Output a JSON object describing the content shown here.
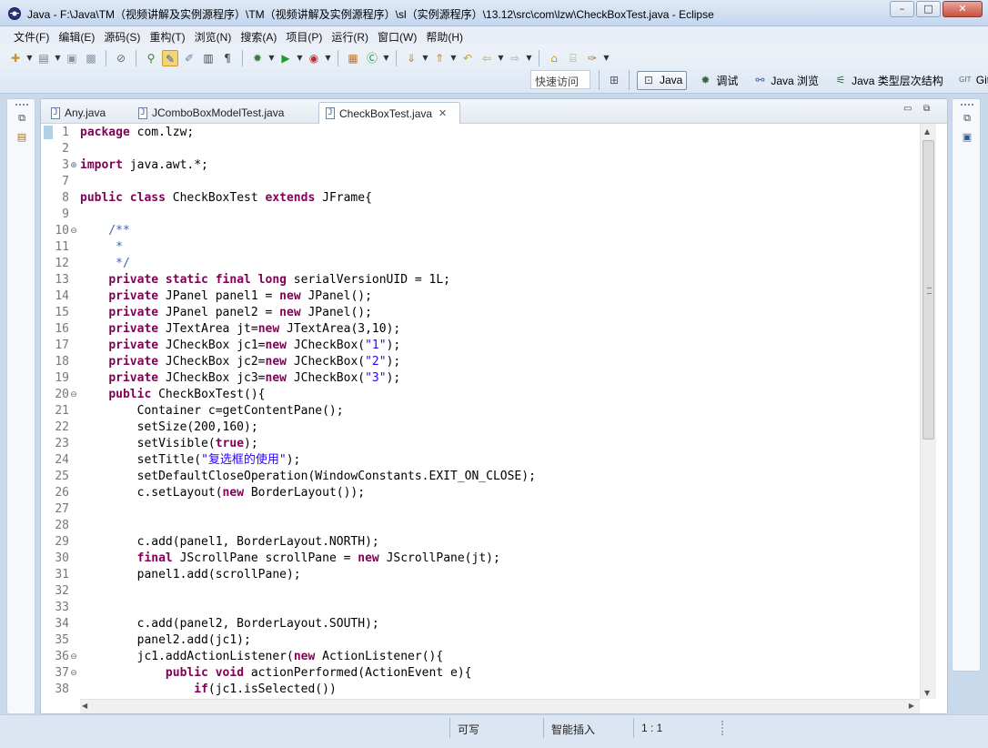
{
  "window": {
    "title": "Java  -  F:\\Java\\TM（视频讲解及实例源程序）\\TM（视频讲解及实例源程序）\\sl（实例源程序）\\13.12\\src\\com\\lzw\\CheckBoxTest.java  -  Eclipse",
    "minimize_glyph": "–",
    "maximize_glyph": "□",
    "close_glyph": "✕"
  },
  "menu": [
    "文件(F)",
    "编辑(E)",
    "源码(S)",
    "重构(T)",
    "浏览(N)",
    "搜索(A)",
    "项目(P)",
    "运行(R)",
    "窗口(W)",
    "帮助(H)"
  ],
  "toolbar": {
    "quick_access": "快速访问",
    "perspectives": [
      {
        "label": "Java",
        "icon": "java-perspective-icon",
        "active": true
      },
      {
        "label": "调试",
        "icon": "debug-icon",
        "active": false
      },
      {
        "label": "Java 浏览",
        "icon": "java-browse-icon",
        "active": false
      },
      {
        "label": "Java 类型层次结构",
        "icon": "type-hierarchy-icon",
        "active": false
      },
      {
        "label": "Git",
        "icon": "git-icon",
        "active": false
      }
    ]
  },
  "editor": {
    "tabs": [
      {
        "label": "Any.java",
        "active": false
      },
      {
        "label": "JComboBoxModelTest.java",
        "active": false
      },
      {
        "label": "CheckBoxTest.java",
        "active": true
      }
    ],
    "lines": [
      {
        "n": "1",
        "fold": "",
        "tokens": [
          {
            "c": "kw",
            "t": "package"
          },
          {
            "c": "",
            "t": " com.lzw;"
          }
        ]
      },
      {
        "n": "2",
        "fold": "",
        "tokens": []
      },
      {
        "n": "3",
        "fold": "plus",
        "tokens": [
          {
            "c": "kw",
            "t": "import"
          },
          {
            "c": "",
            "t": " java.awt.*;"
          }
        ]
      },
      {
        "n": "7",
        "fold": "",
        "tokens": []
      },
      {
        "n": "8",
        "fold": "",
        "tokens": [
          {
            "c": "kw",
            "t": "public class"
          },
          {
            "c": "",
            "t": " CheckBoxTest "
          },
          {
            "c": "kw",
            "t": "extends"
          },
          {
            "c": "",
            "t": " JFrame{"
          }
        ]
      },
      {
        "n": "9",
        "fold": "",
        "tokens": []
      },
      {
        "n": "10",
        "fold": "minus",
        "tokens": [
          {
            "c": "cmt",
            "t": "    /**"
          }
        ]
      },
      {
        "n": "11",
        "fold": "",
        "tokens": [
          {
            "c": "cmt",
            "t": "     *"
          }
        ]
      },
      {
        "n": "12",
        "fold": "",
        "tokens": [
          {
            "c": "cmt",
            "t": "     */"
          }
        ]
      },
      {
        "n": "13",
        "fold": "",
        "tokens": [
          {
            "c": "",
            "t": "    "
          },
          {
            "c": "kw",
            "t": "private static final long"
          },
          {
            "c": "",
            "t": " serialVersionUID = 1L;"
          }
        ]
      },
      {
        "n": "14",
        "fold": "",
        "tokens": [
          {
            "c": "",
            "t": "    "
          },
          {
            "c": "kw",
            "t": "private"
          },
          {
            "c": "",
            "t": " JPanel panel1 = "
          },
          {
            "c": "kw",
            "t": "new"
          },
          {
            "c": "",
            "t": " JPanel();"
          }
        ]
      },
      {
        "n": "15",
        "fold": "",
        "tokens": [
          {
            "c": "",
            "t": "    "
          },
          {
            "c": "kw",
            "t": "private"
          },
          {
            "c": "",
            "t": " JPanel panel2 = "
          },
          {
            "c": "kw",
            "t": "new"
          },
          {
            "c": "",
            "t": " JPanel();"
          }
        ]
      },
      {
        "n": "16",
        "fold": "",
        "tokens": [
          {
            "c": "",
            "t": "    "
          },
          {
            "c": "kw",
            "t": "private"
          },
          {
            "c": "",
            "t": " JTextArea jt="
          },
          {
            "c": "kw",
            "t": "new"
          },
          {
            "c": "",
            "t": " JTextArea(3,10);"
          }
        ]
      },
      {
        "n": "17",
        "fold": "",
        "tokens": [
          {
            "c": "",
            "t": "    "
          },
          {
            "c": "kw",
            "t": "private"
          },
          {
            "c": "",
            "t": " JCheckBox jc1="
          },
          {
            "c": "kw",
            "t": "new"
          },
          {
            "c": "",
            "t": " JCheckBox("
          },
          {
            "c": "str",
            "t": "\"1\""
          },
          {
            "c": "",
            "t": ");"
          }
        ]
      },
      {
        "n": "18",
        "fold": "",
        "tokens": [
          {
            "c": "",
            "t": "    "
          },
          {
            "c": "kw",
            "t": "private"
          },
          {
            "c": "",
            "t": " JCheckBox jc2="
          },
          {
            "c": "kw",
            "t": "new"
          },
          {
            "c": "",
            "t": " JCheckBox("
          },
          {
            "c": "str",
            "t": "\"2\""
          },
          {
            "c": "",
            "t": ");"
          }
        ]
      },
      {
        "n": "19",
        "fold": "",
        "tokens": [
          {
            "c": "",
            "t": "    "
          },
          {
            "c": "kw",
            "t": "private"
          },
          {
            "c": "",
            "t": " JCheckBox jc3="
          },
          {
            "c": "kw",
            "t": "new"
          },
          {
            "c": "",
            "t": " JCheckBox("
          },
          {
            "c": "str",
            "t": "\"3\""
          },
          {
            "c": "",
            "t": ");"
          }
        ]
      },
      {
        "n": "20",
        "fold": "minus",
        "tokens": [
          {
            "c": "",
            "t": "    "
          },
          {
            "c": "kw",
            "t": "public"
          },
          {
            "c": "",
            "t": " CheckBoxTest(){"
          }
        ]
      },
      {
        "n": "21",
        "fold": "",
        "tokens": [
          {
            "c": "",
            "t": "        Container c=getContentPane();"
          }
        ]
      },
      {
        "n": "22",
        "fold": "",
        "tokens": [
          {
            "c": "",
            "t": "        setSize(200,160);"
          }
        ]
      },
      {
        "n": "23",
        "fold": "",
        "tokens": [
          {
            "c": "",
            "t": "        setVisible("
          },
          {
            "c": "kw",
            "t": "true"
          },
          {
            "c": "",
            "t": ");"
          }
        ]
      },
      {
        "n": "24",
        "fold": "",
        "tokens": [
          {
            "c": "",
            "t": "        setTitle("
          },
          {
            "c": "str",
            "t": "\"复选框的使用\""
          },
          {
            "c": "",
            "t": ");"
          }
        ]
      },
      {
        "n": "25",
        "fold": "",
        "tokens": [
          {
            "c": "",
            "t": "        setDefaultCloseOperation(WindowConstants.EXIT_ON_CLOSE);"
          }
        ]
      },
      {
        "n": "26",
        "fold": "",
        "tokens": [
          {
            "c": "",
            "t": "        c.setLayout("
          },
          {
            "c": "kw",
            "t": "new"
          },
          {
            "c": "",
            "t": " BorderLayout());"
          }
        ]
      },
      {
        "n": "27",
        "fold": "",
        "tokens": []
      },
      {
        "n": "28",
        "fold": "",
        "tokens": []
      },
      {
        "n": "29",
        "fold": "",
        "tokens": [
          {
            "c": "",
            "t": "        c.add(panel1, BorderLayout.NORTH);"
          }
        ]
      },
      {
        "n": "30",
        "fold": "",
        "tokens": [
          {
            "c": "",
            "t": "        "
          },
          {
            "c": "kw",
            "t": "final"
          },
          {
            "c": "",
            "t": " JScrollPane scrollPane = "
          },
          {
            "c": "kw",
            "t": "new"
          },
          {
            "c": "",
            "t": " JScrollPane(jt);"
          }
        ]
      },
      {
        "n": "31",
        "fold": "",
        "tokens": [
          {
            "c": "",
            "t": "        panel1.add(scrollPane);"
          }
        ]
      },
      {
        "n": "32",
        "fold": "",
        "tokens": []
      },
      {
        "n": "33",
        "fold": "",
        "tokens": []
      },
      {
        "n": "34",
        "fold": "",
        "tokens": [
          {
            "c": "",
            "t": "        c.add(panel2, BorderLayout.SOUTH);"
          }
        ]
      },
      {
        "n": "35",
        "fold": "",
        "tokens": [
          {
            "c": "",
            "t": "        panel2.add(jc1);"
          }
        ]
      },
      {
        "n": "36",
        "fold": "minus",
        "tokens": [
          {
            "c": "",
            "t": "        jc1.addActionListener("
          },
          {
            "c": "kw",
            "t": "new"
          },
          {
            "c": "",
            "t": " ActionListener(){"
          }
        ]
      },
      {
        "n": "37",
        "fold": "minus",
        "tokens": [
          {
            "c": "",
            "t": "            "
          },
          {
            "c": "kw",
            "t": "public void"
          },
          {
            "c": "",
            "t": " actionPerformed(ActionEvent e){"
          }
        ]
      },
      {
        "n": "38",
        "fold": "",
        "tokens": [
          {
            "c": "",
            "t": "                "
          },
          {
            "c": "kw",
            "t": "if"
          },
          {
            "c": "",
            "t": "(jc1.isSelected())"
          }
        ]
      }
    ]
  },
  "status": {
    "writable": "可写",
    "insert_mode": "智能插入",
    "position": "1 : 1"
  },
  "colors": {
    "keyword": "#7f0055",
    "string": "#2a00ff",
    "javadoc": "#3f5fbf",
    "line_number": "#787878"
  }
}
